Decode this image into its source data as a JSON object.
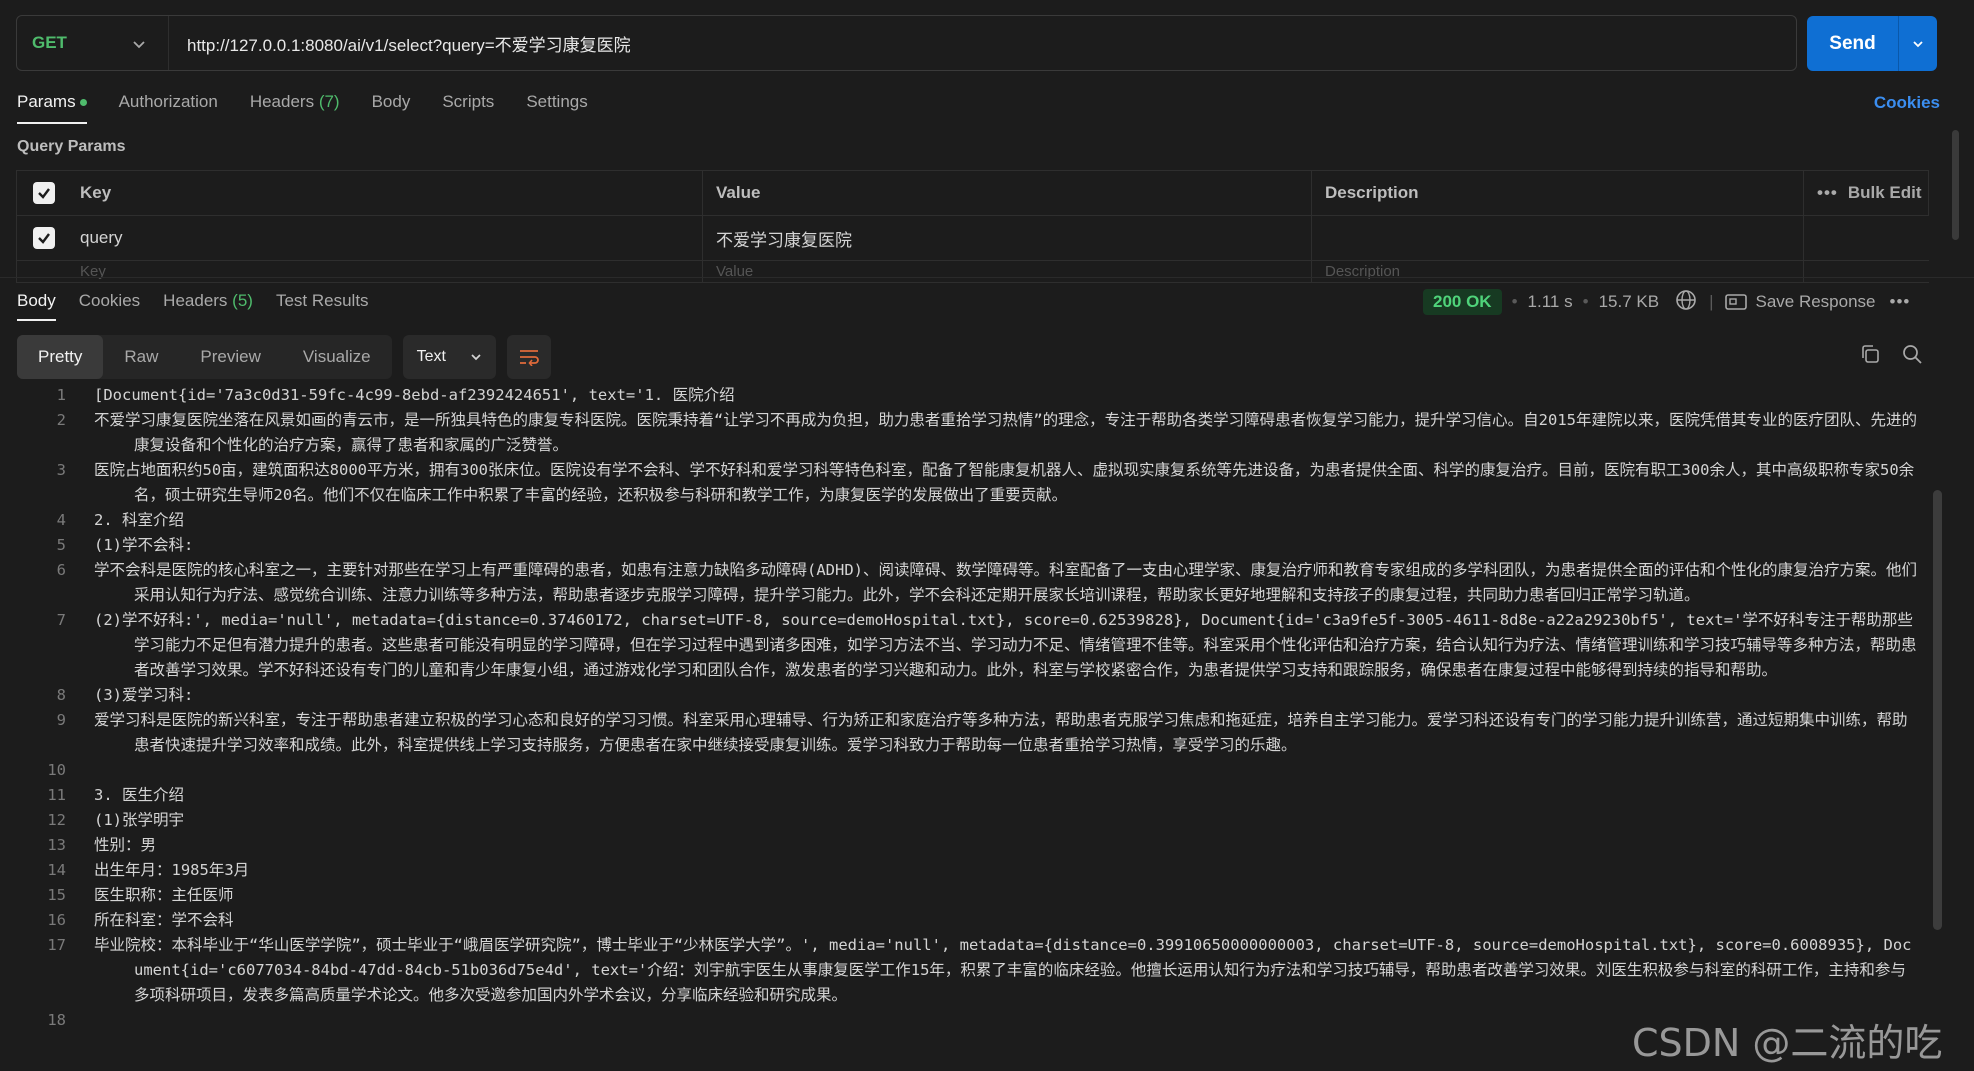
{
  "request": {
    "method": "GET",
    "url": "http://127.0.0.1:8080/ai/v1/select?query=不爱学习康复医院",
    "send_label": "Send"
  },
  "request_tabs": [
    {
      "label": "Params",
      "active": true,
      "has_dot": true
    },
    {
      "label": "Authorization"
    },
    {
      "label": "Headers",
      "count": "(7)"
    },
    {
      "label": "Body"
    },
    {
      "label": "Scripts"
    },
    {
      "label": "Settings"
    }
  ],
  "cookies_link": "Cookies",
  "query_params": {
    "title": "Query Params",
    "headers": {
      "key": "Key",
      "value": "Value",
      "description": "Description",
      "bulk_edit": "Bulk Edit"
    },
    "rows": [
      {
        "key": "query",
        "value": "不爱学习康复医院",
        "checked": true
      }
    ],
    "placeholder": {
      "key": "Key",
      "value": "Value",
      "description": "Description"
    }
  },
  "response_tabs": [
    {
      "label": "Body",
      "active": true
    },
    {
      "label": "Cookies"
    },
    {
      "label": "Headers",
      "count": "(5)"
    },
    {
      "label": "Test Results"
    }
  ],
  "response_meta": {
    "status": "200 OK",
    "time": "1.11 s",
    "size": "15.7 KB",
    "save_label": "Save Response"
  },
  "view_modes": [
    "Pretty",
    "Raw",
    "Preview",
    "Visualize"
  ],
  "active_view": "Pretty",
  "format": "Text",
  "code_lines": [
    {
      "n": "1",
      "text": "[Document{id='7a3c0d31-59fc-4c99-8ebd-af2392424651', text='1. 医院介绍"
    },
    {
      "n": "2",
      "text": "不爱学习康复医院坐落在风景如画的青云市，是一所独具特色的康复专科医院。医院秉持着“让学习不再成为负担，助力患者重拾学习热情”的理念，专注于帮助各类学习障碍患者恢复学习能力，提升学习信心。自2015年建院以来，医院凭借其专业的医疗团队、先进的康复设备和个性化的治疗方案，赢得了患者和家属的广泛赞誉。"
    },
    {
      "n": "3",
      "text": "医院占地面积约50亩，建筑面积达8000平方米，拥有300张床位。医院设有学不会科、学不好科和爱学习科等特色科室，配备了智能康复机器人、虚拟现实康复系统等先进设备，为患者提供全面、科学的康复治疗。目前，医院有职工300余人，其中高级职称专家50余名，硕士研究生导师20名。他们不仅在临床工作中积累了丰富的经验，还积极参与科研和教学工作，为康复医学的发展做出了重要贡献。"
    },
    {
      "n": "4",
      "text": "2. 科室介绍"
    },
    {
      "n": "5",
      "text": "(1)学不会科:"
    },
    {
      "n": "6",
      "text": "学不会科是医院的核心科室之一，主要针对那些在学习上有严重障碍的患者，如患有注意力缺陷多动障碍(ADHD)、阅读障碍、数学障碍等。科室配备了一支由心理学家、康复治疗师和教育专家组成的多学科团队，为患者提供全面的评估和个性化的康复治疗方案。他们采用认知行为疗法、感觉统合训练、注意力训练等多种方法，帮助患者逐步克服学习障碍，提升学习能力。此外，学不会科还定期开展家长培训课程，帮助家长更好地理解和支持孩子的康复过程，共同助力患者回归正常学习轨道。"
    },
    {
      "n": "7",
      "text": "(2)学不好科:', media='null', metadata={distance=0.37460172, charset=UTF-8, source=demoHospital.txt}, score=0.62539828}, Document{id='c3a9fe5f-3005-4611-8d8e-a22a29230bf5', text='学不好科专注于帮助那些学习能力不足但有潜力提升的患者。这些患者可能没有明显的学习障碍，但在学习过程中遇到诸多困难，如学习方法不当、学习动力不足、情绪管理不佳等。科室采用个性化评估和治疗方案，结合认知行为疗法、情绪管理训练和学习技巧辅导等多种方法，帮助患者改善学习效果。学不好科还设有专门的儿童和青少年康复小组，通过游戏化学习和团队合作，激发患者的学习兴趣和动力。此外，科室与学校紧密合作，为患者提供学习支持和跟踪服务，确保患者在康复过程中能够得到持续的指导和帮助。"
    },
    {
      "n": "8",
      "text": "(3)爱学习科:"
    },
    {
      "n": "9",
      "text": "爱学习科是医院的新兴科室，专注于帮助患者建立积极的学习心态和良好的学习习惯。科室采用心理辅导、行为矫正和家庭治疗等多种方法，帮助患者克服学习焦虑和拖延症，培养自主学习能力。爱学习科还设有专门的学习能力提升训练营，通过短期集中训练，帮助患者快速提升学习效率和成绩。此外，科室提供线上学习支持服务，方便患者在家中继续接受康复训练。爱学习科致力于帮助每一位患者重拾学习热情，享受学习的乐趣。"
    },
    {
      "n": "10",
      "text": ""
    },
    {
      "n": "11",
      "text": "3. 医生介绍"
    },
    {
      "n": "12",
      "text": "(1)张学明宇"
    },
    {
      "n": "13",
      "text": "性别：男"
    },
    {
      "n": "14",
      "text": "出生年月：1985年3月"
    },
    {
      "n": "15",
      "text": "医生职称：主任医师"
    },
    {
      "n": "16",
      "text": "所在科室：学不会科"
    },
    {
      "n": "17",
      "text": "毕业院校：本科毕业于“华山医学学院”，硕士毕业于“峨眉医学研究院”，博士毕业于“少林医学大学”。', media='null', metadata={distance=0.39910650000000003, charset=UTF-8, source=demoHospital.txt}, score=0.6008935}, Document{id='c6077034-84bd-47dd-84cb-51b036d75e4d', text='介绍：刘宇航宇医生从事康复医学工作15年，积累了丰富的临床经验。他擅长运用认知行为疗法和学习技巧辅导，帮助患者改善学习效果。刘医生积极参与科室的科研工作，主持和参与多项科研项目，发表多篇高质量学术论文。他多次受邀参加国内外学术会议，分享临床经验和研究成果。"
    },
    {
      "n": "18",
      "text": ""
    }
  ],
  "watermark": "CSDN @二流的吃货",
  "colors": {
    "accent": "#0f6fd3",
    "status_green": "#4fd37a",
    "method_green": "#4fbb6c",
    "link_blue": "#3b8ef0"
  }
}
